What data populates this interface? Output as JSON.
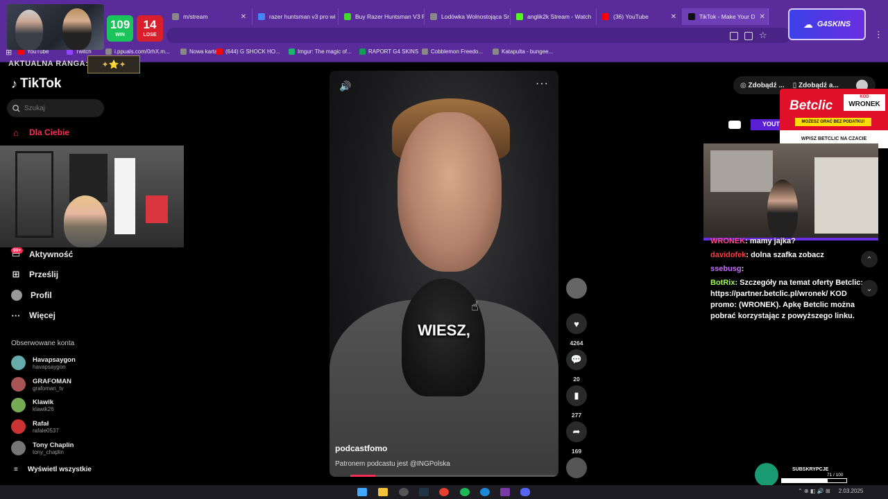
{
  "browser": {
    "tabs": [
      {
        "label": "m/stream",
        "color": "#888"
      },
      {
        "label": "razer huntsman v3 pro wi",
        "color": "#4285f4"
      },
      {
        "label": "Buy Razer Huntsman V3 P",
        "color": "#44d62c"
      },
      {
        "label": "Lodówka Wolnostojąca Sr",
        "color": "#888"
      },
      {
        "label": "anglik2k Stream - Watch",
        "color": "#53fc18"
      },
      {
        "label": "(36) YouTube",
        "color": "#ff0000"
      },
      {
        "label": "TikTok - Make Your D",
        "color": "#111"
      }
    ],
    "bookmarks": [
      {
        "label": "YouTube",
        "color": "#ff0000"
      },
      {
        "label": "Twitch",
        "color": "#9146ff"
      },
      {
        "label": "i.ppuals.com/0rhX.m...",
        "color": "#888"
      },
      {
        "label": "Nowa karta",
        "color": "#888"
      },
      {
        "label": "(644) G SHOCK HO...",
        "color": "#ff0000"
      },
      {
        "label": "Imgur: The magic of...",
        "color": "#1bb76e"
      },
      {
        "label": "RAPORT G4 SKINS",
        "color": "#0f9d58"
      },
      {
        "label": "Cobblemon Freedo...",
        "color": "#888"
      },
      {
        "label": "Katapulta - bungee...",
        "color": "#888"
      }
    ]
  },
  "overlay": {
    "wins": "109",
    "wins_label": "WIN",
    "losses": "14",
    "losses_label": "LOSE",
    "rank_label": "AKTUALNA RANGA:",
    "g4skins": "G4SKINS",
    "subs_label": "SUBSKRYPCJE",
    "subs_count": "71 / 100",
    "subs_progress": 0.71
  },
  "sidebar": {
    "logo": "TikTok",
    "search_placeholder": "Szukaj",
    "nav": [
      {
        "label": "Dla Ciebie",
        "icon": "home-icon",
        "active": true
      },
      {
        "label": "Aktywność",
        "icon": "inbox-icon"
      },
      {
        "label": "Prześlij",
        "icon": "upload-icon"
      },
      {
        "label": "Profil",
        "icon": "profile-icon"
      },
      {
        "label": "Więcej",
        "icon": "more-icon"
      }
    ],
    "activity_badge": "99+",
    "followed_heading": "Obserwowane konta",
    "followed": [
      {
        "name": "Havapsaygon",
        "handle": "havapsaygon",
        "color": "#6aa"
      },
      {
        "name": "GRAFOMAN",
        "handle": "grafoman_tv",
        "color": "#a55"
      },
      {
        "name": "Klawik",
        "handle": "klawik26",
        "color": "#7a5"
      },
      {
        "name": "Rafał",
        "handle": "rafale0537",
        "color": "#c33"
      },
      {
        "name": "Tony Chaplin",
        "handle": "tony_chaplin",
        "color": "#777"
      }
    ],
    "show_all": "Wyświetl wszystkie"
  },
  "video": {
    "caption": "WIESZ,",
    "author": "podcastfomo",
    "description": "Patronem podcastu jest @INGPolska",
    "progress": 0.12,
    "likes": "4264",
    "comments": "20",
    "saves": "277",
    "shares": "169"
  },
  "right": {
    "chips": [
      "Zdobądź ...",
      "Zdobądź a..."
    ],
    "betclic": {
      "name": "Betclic",
      "code_label": "KOD",
      "code": "WRONEK",
      "strip": "MOŻESZ GRAĆ BEZ PODATKU!",
      "footer": "WPISZ BETCLIC NA CZACIE"
    },
    "yt_label": "YOUT",
    "chat": [
      {
        "user": "WRONEK",
        "text": ": mamy jajka?",
        "color": "#ff4a8a"
      },
      {
        "user": "davidofek",
        "text": ": dolna szafka zobacz",
        "color": "#ff3b3b"
      },
      {
        "user": "ssebusg",
        "text": ":",
        "color": "#c86cff"
      },
      {
        "user": "BotRix",
        "text": ": Szczegóły na temat oferty Betclic: https://partner.betclic.pl/wronek/ KOD promo: (WRONEK). Apkę Betclic można pobrać korzystając z powyższego linku.",
        "color": "#9dff4a"
      }
    ]
  },
  "taskbar": {
    "tray_date": "2.03.2025"
  }
}
